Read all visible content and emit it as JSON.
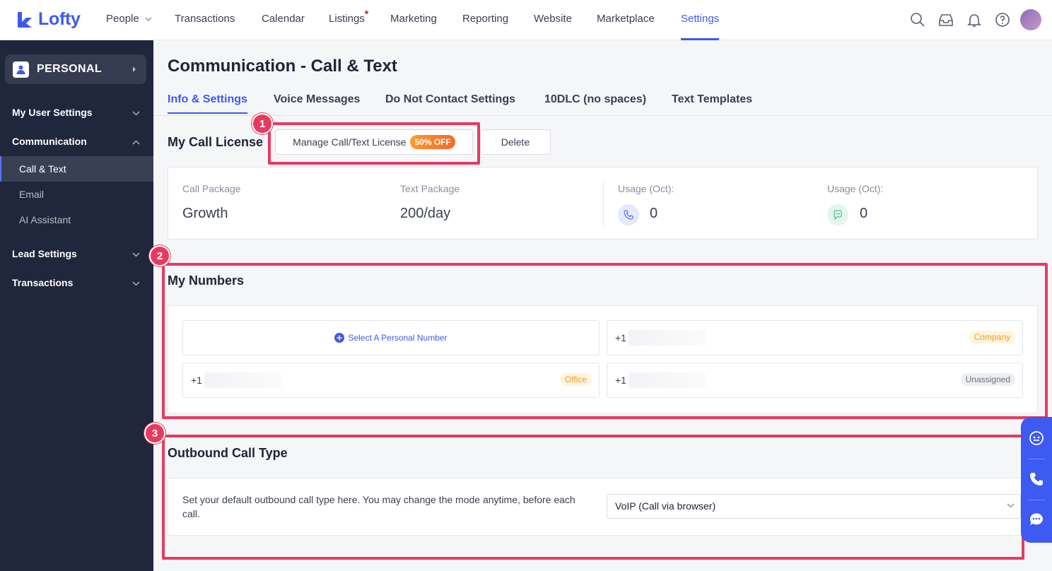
{
  "brand": {
    "name": "Lofty",
    "color": "#3d5af1"
  },
  "nav": {
    "items": [
      {
        "label": "People",
        "has_dropdown": true
      },
      {
        "label": "Transactions"
      },
      {
        "label": "Calendar"
      },
      {
        "label": "Listings",
        "has_notification_dot": true
      },
      {
        "label": "Marketing"
      },
      {
        "label": "Reporting"
      },
      {
        "label": "Website"
      },
      {
        "label": "Marketplace"
      },
      {
        "label": "Settings",
        "active": true
      }
    ],
    "icons": [
      "search-icon",
      "inbox-icon",
      "bell-icon",
      "help-icon",
      "avatar"
    ]
  },
  "sidebar": {
    "scope_label": "PERSONAL",
    "groups": [
      {
        "label": "My User Settings",
        "expanded": false
      },
      {
        "label": "Communication",
        "expanded": true,
        "items": [
          {
            "label": "Call & Text",
            "active": true
          },
          {
            "label": "Email"
          },
          {
            "label": "AI Assistant"
          }
        ]
      },
      {
        "label": "Lead Settings",
        "expanded": false
      },
      {
        "label": "Transactions",
        "expanded": false
      }
    ]
  },
  "page": {
    "title": "Communication - Call & Text",
    "tabs": [
      {
        "label": "Info & Settings",
        "active": true
      },
      {
        "label": "Voice Messages"
      },
      {
        "label": "Do Not Contact Settings"
      },
      {
        "label": "10DLC (no spaces)"
      },
      {
        "label": "Text Templates"
      }
    ]
  },
  "license": {
    "title": "My Call License",
    "manage_button": "Manage Call/Text License",
    "discount_badge": "50% OFF",
    "delete_button": "Delete",
    "call_package_label": "Call Package",
    "call_package_value": "Growth",
    "text_package_label": "Text Package",
    "text_package_value": "200/day",
    "call_usage_label": "Usage (Oct):",
    "call_usage_value": "0",
    "text_usage_label": "Usage (Oct):",
    "text_usage_value": "0"
  },
  "numbers": {
    "title": "My Numbers",
    "select_personal": "Select A Personal Number",
    "entries": [
      {
        "prefix": "+1",
        "tag": "Company"
      },
      {
        "prefix": "+1",
        "tag": "Office"
      },
      {
        "prefix": "+1",
        "tag": "Unassigned"
      }
    ]
  },
  "outbound": {
    "title": "Outbound Call Type",
    "description": "Set your default outbound call type here. You may change the mode anytime, before each call.",
    "selected": "VoIP (Call via browser)"
  },
  "annotations": {
    "markers": [
      "1",
      "2",
      "3"
    ],
    "color": "#e83a5f"
  },
  "colors": {
    "sidebar_bg": "#20263c",
    "accent": "#3d5af1",
    "tag_company": "#f0a020",
    "tag_office": "#f0a020",
    "tag_unassigned": "#6b7080"
  }
}
